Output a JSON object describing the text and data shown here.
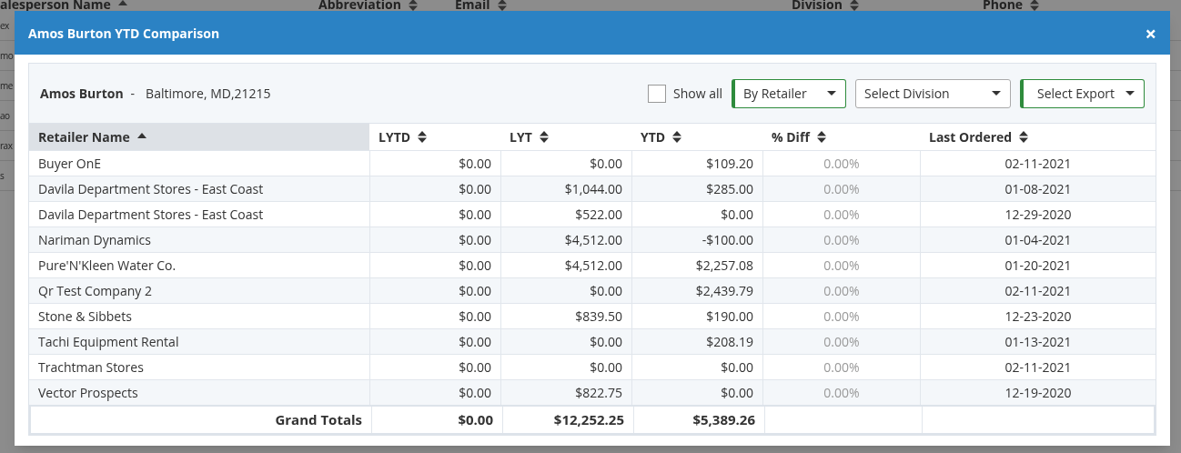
{
  "background": {
    "columns": [
      {
        "label": "alesperson Name",
        "sorted": true
      },
      {
        "label": "Abbreviation",
        "sorted": false
      },
      {
        "label": "Email",
        "sorted": false
      },
      {
        "label": "Division",
        "sorted": false
      },
      {
        "label": "Phone",
        "sorted": false
      }
    ],
    "row_fragments": [
      "ex",
      "mo",
      "me",
      "ao",
      "rax",
      "s"
    ]
  },
  "modal": {
    "title": "Amos Burton YTD Comparison",
    "close": "×",
    "person": {
      "name": "Amos Burton",
      "separator": "-",
      "location": "Baltimore, MD,21215"
    },
    "show_all": {
      "label": "Show all",
      "checked": false
    },
    "selects": [
      {
        "label": "By Retailer",
        "accent": true
      },
      {
        "label": "Select Division",
        "accent": false
      },
      {
        "label": "Select Export",
        "accent": true
      }
    ],
    "table": {
      "columns": [
        {
          "label": "Retailer Name",
          "sorted": true
        },
        {
          "label": "LYTD",
          "sorted": false
        },
        {
          "label": "LYT",
          "sorted": false
        },
        {
          "label": "YTD",
          "sorted": false
        },
        {
          "label": "% Diff",
          "sorted": false
        },
        {
          "label": "Last Ordered",
          "sorted": false
        }
      ],
      "rows": [
        [
          "Buyer OnE",
          "$0.00",
          "$0.00",
          "$109.20",
          "0.00%",
          "02-11-2021"
        ],
        [
          "Davila Department Stores - East Coast",
          "$0.00",
          "$1,044.00",
          "$285.00",
          "0.00%",
          "01-08-2021"
        ],
        [
          "Davila Department Stores - East Coast",
          "$0.00",
          "$522.00",
          "$0.00",
          "0.00%",
          "12-29-2020"
        ],
        [
          "Nariman Dynamics",
          "$0.00",
          "$4,512.00",
          "-$100.00",
          "0.00%",
          "01-04-2021"
        ],
        [
          "Pure'N'Kleen Water Co.",
          "$0.00",
          "$4,512.00",
          "$2,257.08",
          "0.00%",
          "01-20-2021"
        ],
        [
          "Qr Test Company 2",
          "$0.00",
          "$0.00",
          "$2,439.79",
          "0.00%",
          "02-11-2021"
        ],
        [
          "Stone & Sibbets",
          "$0.00",
          "$839.50",
          "$190.00",
          "0.00%",
          "12-23-2020"
        ],
        [
          "Tachi Equipment Rental",
          "$0.00",
          "$0.00",
          "$208.19",
          "0.00%",
          "01-13-2021"
        ],
        [
          "Trachtman Stores",
          "$0.00",
          "$0.00",
          "$0.00",
          "0.00%",
          "02-11-2021"
        ],
        [
          "Vector Prospects",
          "$0.00",
          "$822.75",
          "$0.00",
          "0.00%",
          "12-19-2020"
        ]
      ],
      "totals": [
        "Grand Totals",
        "$0.00",
        "$12,252.25",
        "$5,389.26"
      ]
    }
  }
}
